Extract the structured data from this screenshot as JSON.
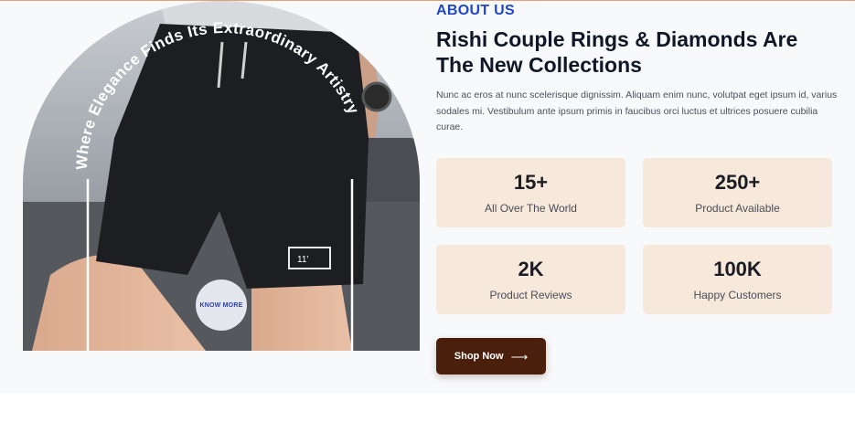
{
  "about": {
    "eyebrow": "ABOUT US",
    "heading": "Rishi Couple Rings & Diamonds Are The New Collections",
    "description": "Nunc ac eros at nunc scelerisque dignissim. Aliquam enim nunc, volutpat eget ipsum id, varius sodales mi. Vestibulum ante ipsum primis in faucibus orci luctus et ultrices posuere cubilia curae."
  },
  "image": {
    "curved_text": "Where Elegance Finds Its Extraordinary Artistry",
    "know_more_label": "KNOW MORE",
    "shorts_tag_text": "11'"
  },
  "stats": [
    {
      "value": "15+",
      "label": "All Over The World"
    },
    {
      "value": "250+",
      "label": "Product Available"
    },
    {
      "value": "2K",
      "label": "Product Reviews"
    },
    {
      "value": "100K",
      "label": "Happy Customers"
    }
  ],
  "cta": {
    "label": "Shop Now",
    "icon": "arrow-right-icon"
  },
  "colors": {
    "accent_blue": "#1f48c8",
    "stat_card_bg": "#f6e9db",
    "button_bg": "#4a1f0b"
  }
}
